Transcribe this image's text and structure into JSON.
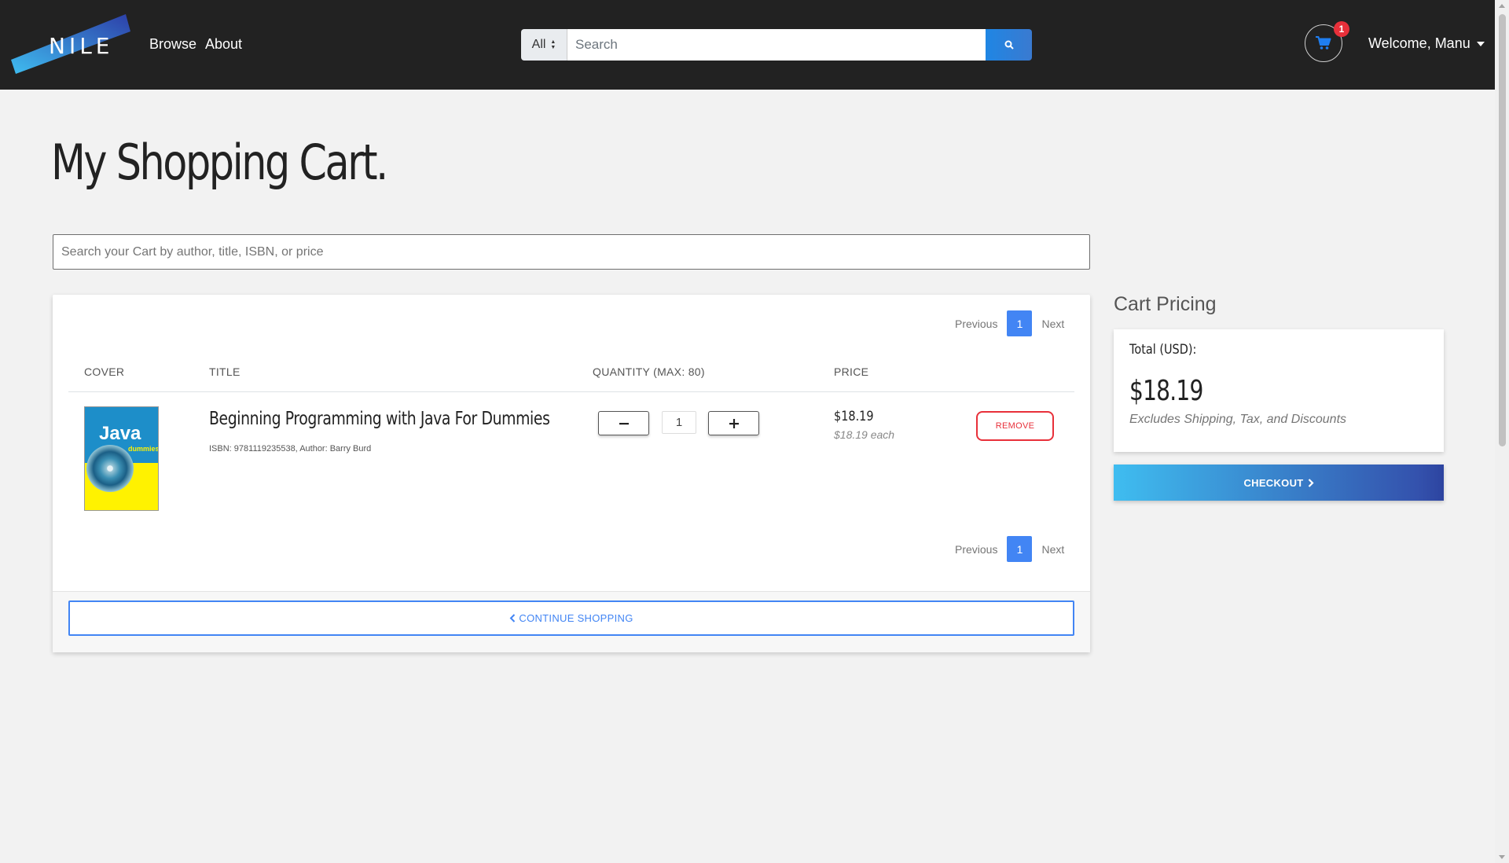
{
  "brand": {
    "logo_text": "NILE"
  },
  "nav": {
    "links": [
      "Browse",
      "About"
    ],
    "search": {
      "category": "All",
      "placeholder": "Search"
    },
    "cart_count": "1",
    "welcome": "Welcome, Manu"
  },
  "page": {
    "title": "My Shopping Cart.",
    "cart_search_placeholder": "Search your Cart by author, title, ISBN, or price"
  },
  "cart": {
    "pagination": {
      "previous": "Previous",
      "current": "1",
      "next": "Next"
    },
    "columns": [
      "COVER",
      "TITLE",
      "QUANTITY (MAX: 80)",
      "PRICE"
    ],
    "items": [
      {
        "cover": {
          "title_text": "Java",
          "series_text": "dummies"
        },
        "title": "Beginning Programming with Java For Dummies",
        "meta": "ISBN: 9781119235538, Author: Barry Burd",
        "quantity": "1",
        "price": "$18.19",
        "price_each": "$18.19 each",
        "remove_label": "REMOVE"
      }
    ],
    "continue_label": "CONTINUE SHOPPING"
  },
  "pricing": {
    "title": "Cart Pricing",
    "total_label": "Total (USD):",
    "total_value": "$18.19",
    "note": "Excludes Shipping, Tax, and Discounts",
    "checkout_label": "CHECKOUT"
  },
  "colors": {
    "navbar": "#222222",
    "accent_blue": "#4285f4",
    "remove_red": "#e8303a",
    "badge_red": "#e8303a"
  },
  "icons": {
    "search": "search-icon",
    "cart": "cart-icon",
    "chevron_left": "chevron-left-icon",
    "chevron_right": "chevron-right-icon",
    "caret_down": "caret-down-icon"
  }
}
